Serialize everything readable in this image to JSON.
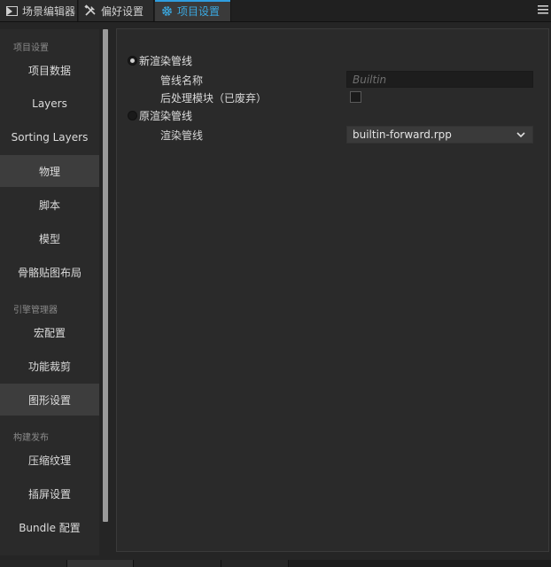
{
  "tabs": [
    {
      "label": "场景编辑器",
      "icon": "scene-editor-icon"
    },
    {
      "label": "偏好设置",
      "icon": "tools-icon"
    },
    {
      "label": "项目设置",
      "icon": "gear-icon",
      "active": true
    }
  ],
  "sidebar": {
    "sections": [
      {
        "title": "项目设置",
        "items": [
          "项目数据",
          "Layers",
          "Sorting Layers",
          "物理",
          "脚本",
          "模型",
          "骨骼贴图布局"
        ]
      },
      {
        "title": "引擎管理器",
        "items": [
          "宏配置",
          "功能裁剪",
          "图形设置"
        ]
      },
      {
        "title": "构建发布",
        "items": [
          "压缩纹理",
          "插屏设置",
          "Bundle 配置"
        ]
      }
    ],
    "active_items": [
      "物理",
      "图形设置"
    ]
  },
  "content": {
    "new_pipeline": {
      "label": "新渲染管线",
      "selected": true,
      "name_label": "管线名称",
      "name_placeholder": "Builtin",
      "postprocess_label": "后处理模块（已废弃）",
      "postprocess_checked": false
    },
    "legacy_pipeline": {
      "label": "原渲染管线",
      "selected": false,
      "pipeline_label": "渲染管线",
      "pipeline_value": "builtin-forward.rpp"
    }
  },
  "colors": {
    "accent": "#2f9ee0",
    "panel_bg": "#2a2a2a",
    "active_item_bg": "#3d3d3d"
  }
}
